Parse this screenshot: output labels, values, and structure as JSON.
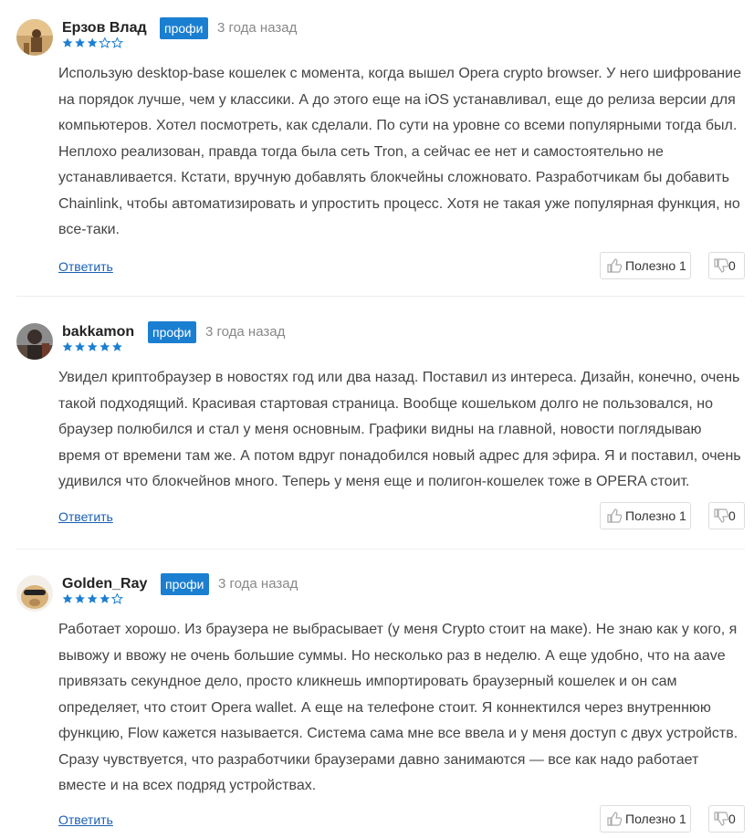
{
  "reviews": [
    {
      "author": "Ерзов Влад",
      "badge": "профи",
      "date": "3 года назад",
      "rating": 3,
      "text": "Использую desktop-base кошелек с момента, когда вышел Opera crypto browser. У него шифрование на порядок лучше, чем у классики. А до этого еще на iOS устанавливал, еще до релиза версии для компьютеров. Хотел посмотреть, как сделали. По сути на уровне со всеми популярными тогда был. Неплохо реализован, правда тогда была сеть Tron, а сейчас ее нет и самостоятельно не устанавливается. Кстати, вручную добавлять блокчейны сложновато. Разработчикам бы добавить Chainlink, чтобы автоматизировать и упростить процесс. Хотя не такая уже популярная функция, но все-таки.",
      "reply": "Ответить",
      "useful_label": "Полезно 1",
      "not_useful_count": "0"
    },
    {
      "author": "bakkamon",
      "badge": "профи",
      "date": "3 года назад",
      "rating": 5,
      "text": "Увидел криптобраузер в новостях год или два назад. Поставил из интереса. Дизайн, конечно, очень такой подходящий. Красивая стартовая страница. Вообще кошельком долго не пользовался, но браузер полюбился и стал у меня основным. Графики видны на главной, новости поглядываю время от времени там же. А потом вдруг понадобился новый адрес для эфира. Я и поставил, очень удивился что блокчейнов много. Теперь у меня еще и полигон-кошелек тоже в OPERA стоит.",
      "reply": "Ответить",
      "useful_label": "Полезно 1",
      "not_useful_count": "0"
    },
    {
      "author": "Golden_Ray",
      "badge": "профи",
      "date": "3 года назад",
      "rating": 4,
      "text": "Работает хорошо. Из браузера не выбрасывает (у меня Crypto стоит на маке). Не знаю как у кого, я вывожу и ввожу не очень большие суммы. Но несколько раз в неделю. А еще удобно, что на aave привязать секундное дело, просто кликнешь импортировать браузерный кошелек и он сам определяет, что стоит Opera wallet. А еще на телефоне стоит. Я коннектился через внутреннюю функцию, Flow кажется называется. Система сама мне все ввела и у меня доступ с двух устройств. Сразу чувствуется, что разработчики браузерами давно занимаются — все как надо работает вместе и на всех подряд устройствах.",
      "reply": "Ответить",
      "useful_label": "Полезно 1",
      "not_useful_count": "0"
    }
  ],
  "colors": {
    "badge_bg": "#1b7fd1",
    "star": "#1b7fd1",
    "link": "#1a5fb4",
    "text": "#444444",
    "muted": "#888888"
  },
  "icons": [
    "avatar",
    "star-icon",
    "thumbs-up-icon",
    "thumbs-down-icon"
  ]
}
